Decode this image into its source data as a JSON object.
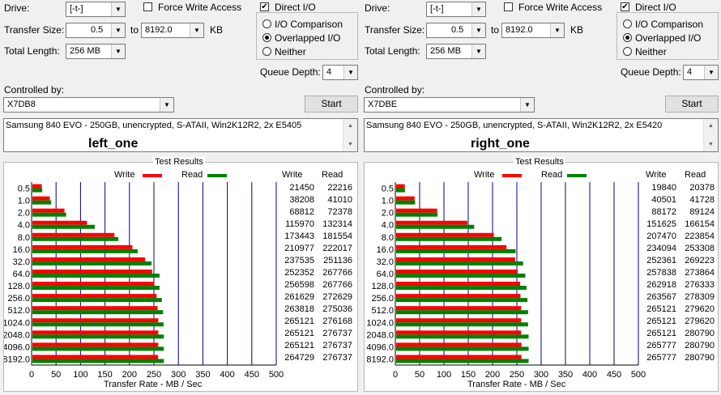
{
  "labels": {
    "drive": "Drive:",
    "transfer_size": "Transfer Size:",
    "to": "to",
    "kb": "KB",
    "total_length": "Total Length:",
    "force_write": "Force Write Access",
    "direct_io": "Direct I/O",
    "io_comparison": "I/O Comparison",
    "overlapped_io": "Overlapped I/O",
    "neither": "Neither",
    "queue_depth": "Queue Depth:",
    "controlled_by": "Controlled by:",
    "start": "Start",
    "test_results": "Test Results",
    "write": "Write",
    "read": "Read",
    "col_write": "Write",
    "col_read": "Read",
    "x_axis_label": "Transfer Rate - MB / Sec"
  },
  "colors": {
    "write": "#ff0000",
    "read": "#008000",
    "grid": "#00008b"
  },
  "panels": [
    {
      "drive": "[-t-]",
      "transfer_from": "0.5",
      "transfer_to": "8192.0",
      "total_length": "256 MB",
      "force_write_checked": false,
      "direct_io_checked": true,
      "io_mode": "overlapped",
      "queue_depth": "4",
      "controller": "X7DB8",
      "description": "Samsung 840 EVO - 250GB, unencrypted, S-ATAII, Win2K12R2, 2x E5405",
      "name": "left_one",
      "rows": [
        {
          "size": "0.5",
          "write": "21450",
          "read": "22216"
        },
        {
          "size": "1.0",
          "write": "38208",
          "read": "41010"
        },
        {
          "size": "2.0",
          "write": "68812",
          "read": "72378"
        },
        {
          "size": "4.0",
          "write": "115970",
          "read": "132314"
        },
        {
          "size": "8.0",
          "write": "173443",
          "read": "181554"
        },
        {
          "size": "16.0",
          "write": "210977",
          "read": "222017"
        },
        {
          "size": "32.0",
          "write": "237535",
          "read": "251136"
        },
        {
          "size": "64.0",
          "write": "252352",
          "read": "267766"
        },
        {
          "size": "128.0",
          "write": "256598",
          "read": "267766"
        },
        {
          "size": "256.0",
          "write": "261629",
          "read": "272629"
        },
        {
          "size": "512.0",
          "write": "263818",
          "read": "275036"
        },
        {
          "size": "1024.0",
          "write": "265121",
          "read": "276168"
        },
        {
          "size": "2048.0",
          "write": "265121",
          "read": "276737"
        },
        {
          "size": "4096.0",
          "write": "265121",
          "read": "276737"
        },
        {
          "size": "8192.0",
          "write": "264729",
          "read": "276737"
        }
      ]
    },
    {
      "drive": "[-t-]",
      "transfer_from": "0.5",
      "transfer_to": "8192.0",
      "total_length": "256 MB",
      "force_write_checked": false,
      "direct_io_checked": true,
      "io_mode": "overlapped",
      "queue_depth": "4",
      "controller": "X7DBE",
      "description": "Samsung 840 EVO - 250GB, unencrypted, S-ATAII, Win2K12R2, 2x E5420",
      "name": "right_one",
      "rows": [
        {
          "size": "0.5",
          "write": "19840",
          "read": "20378"
        },
        {
          "size": "1.0",
          "write": "40501",
          "read": "41728"
        },
        {
          "size": "2.0",
          "write": "88172",
          "read": "89124"
        },
        {
          "size": "4.0",
          "write": "151625",
          "read": "166154"
        },
        {
          "size": "8.0",
          "write": "207470",
          "read": "223854"
        },
        {
          "size": "16.0",
          "write": "234094",
          "read": "253308"
        },
        {
          "size": "32.0",
          "write": "252361",
          "read": "269223"
        },
        {
          "size": "64.0",
          "write": "257838",
          "read": "273864"
        },
        {
          "size": "128.0",
          "write": "262918",
          "read": "276333"
        },
        {
          "size": "256.0",
          "write": "263567",
          "read": "278309"
        },
        {
          "size": "512.0",
          "write": "265121",
          "read": "279620"
        },
        {
          "size": "1024.0",
          "write": "265121",
          "read": "279620"
        },
        {
          "size": "2048.0",
          "write": "265121",
          "read": "280790"
        },
        {
          "size": "4096.0",
          "write": "265777",
          "read": "280790"
        },
        {
          "size": "8192.0",
          "write": "265777",
          "read": "280790"
        }
      ]
    }
  ],
  "chart_data": [
    {
      "type": "bar",
      "orientation": "horizontal",
      "title": "Test Results",
      "xlabel": "Transfer Rate - MB / Sec",
      "ylabel": "",
      "xlim": [
        0,
        500
      ],
      "xticks": [
        0,
        50,
        100,
        150,
        200,
        250,
        300,
        350,
        400,
        450,
        500
      ],
      "categories": [
        "0.5",
        "1.0",
        "2.0",
        "4.0",
        "8.0",
        "16.0",
        "32.0",
        "64.0",
        "128.0",
        "256.0",
        "512.0",
        "1024.0",
        "2048.0",
        "4096.0",
        "8192.0"
      ],
      "series": [
        {
          "name": "Write",
          "values": [
            20.9,
            37.3,
            67.2,
            113.3,
            169.4,
            206.0,
            232.0,
            246.4,
            250.6,
            255.5,
            257.6,
            258.9,
            258.9,
            258.9,
            258.5
          ]
        },
        {
          "name": "Read",
          "values": [
            21.7,
            40.0,
            70.7,
            129.2,
            177.3,
            216.8,
            245.2,
            261.5,
            261.5,
            266.2,
            268.6,
            269.7,
            270.3,
            270.3,
            270.3
          ]
        }
      ]
    },
    {
      "type": "bar",
      "orientation": "horizontal",
      "title": "Test Results",
      "xlabel": "Transfer Rate - MB / Sec",
      "ylabel": "",
      "xlim": [
        0,
        500
      ],
      "xticks": [
        0,
        50,
        100,
        150,
        200,
        250,
        300,
        350,
        400,
        450,
        500
      ],
      "categories": [
        "0.5",
        "1.0",
        "2.0",
        "4.0",
        "8.0",
        "16.0",
        "32.0",
        "64.0",
        "128.0",
        "256.0",
        "512.0",
        "1024.0",
        "2048.0",
        "4096.0",
        "8192.0"
      ],
      "series": [
        {
          "name": "Write",
          "values": [
            19.4,
            39.6,
            86.1,
            148.1,
            202.6,
            228.6,
            246.4,
            251.8,
            256.8,
            257.4,
            258.9,
            258.9,
            258.9,
            259.5,
            259.5
          ]
        },
        {
          "name": "Read",
          "values": [
            19.9,
            40.8,
            87.0,
            162.3,
            218.6,
            247.4,
            262.9,
            267.4,
            269.9,
            271.8,
            273.1,
            273.1,
            274.2,
            274.2,
            274.2
          ]
        }
      ]
    }
  ]
}
